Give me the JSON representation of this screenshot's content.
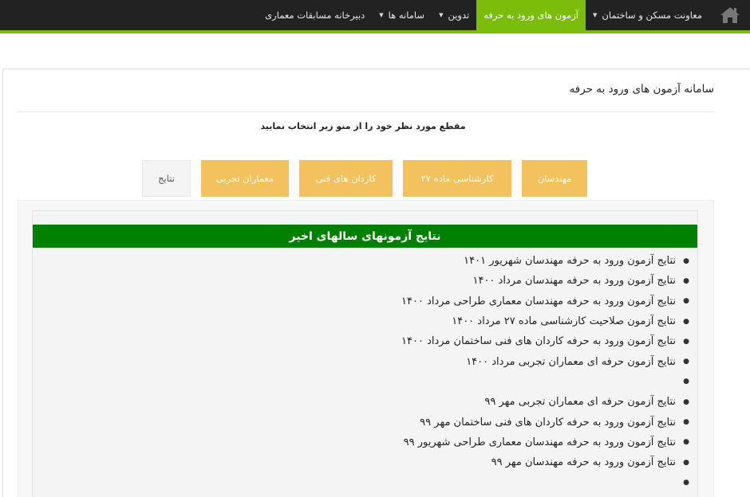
{
  "nav": {
    "home_icon": "home-icon",
    "items": [
      {
        "label": "معاونت مسکن و ساختمان",
        "dropdown": true,
        "active": false
      },
      {
        "label": "آزمون های ورود به حرفه",
        "dropdown": false,
        "active": true
      },
      {
        "label": "تدوین",
        "dropdown": true,
        "active": false
      },
      {
        "label": "سامانه ها",
        "dropdown": true,
        "active": false
      },
      {
        "label": "دبیرخانه مسابقات معماری",
        "dropdown": false,
        "active": false
      }
    ],
    "bar_color": "#222222",
    "accent_color": "#7cbc0a"
  },
  "panel": {
    "title": "سامانه آزمون های ورود به حرفه",
    "instruction": "مقطع مورد نظر خود را از منو زیر انتخاب نمایید"
  },
  "tabs": [
    {
      "label": "مهندسان",
      "style": "orange"
    },
    {
      "label": "کارشناسی ماده ۲۷",
      "style": "orange"
    },
    {
      "label": "کاردان های فنی",
      "style": "orange"
    },
    {
      "label": "معماران تجربی",
      "style": "orange"
    },
    {
      "label": "نتایج",
      "style": "gray",
      "selected": true
    }
  ],
  "tab_orange_color": "#f3c15e",
  "results": {
    "header": "نتایج آزمونهای سالهای اخیر",
    "header_color": "#008000",
    "items": [
      "نتایج آزمون ورود به حرفه مهندسان شهریور ۱۴۰۱",
      "نتایج آزمون ورود به حرفه مهندسان مرداد ۱۴۰۰",
      "نتایج آزمون ورود به حرفه مهندسان معماری طراحی مرداد ۱۴۰۰",
      "نتایج آزمون صلاحیت کارشناسی ماده ۲۷ مرداد ۱۴۰۰",
      "نتایج آزمون ورود به حرفه کاردان های فنی ساختمان مرداد ۱۴۰۰",
      "نتایج آزمون حرفه ای معماران تجربی مرداد ۱۴۰۰",
      "",
      "نتایج آزمون حرفه ای معماران تجربی مهر ۹۹",
      "نتایج آزمون ورود به حرفه کاردان های فنی ساختمان مهر ۹۹",
      "نتایج آزمون ورود به حرفه مهندسان معماری طراحی شهریور ۹۹",
      "نتایج آزمون ورود به حرفه مهندسان مهر ۹۹",
      ""
    ]
  }
}
